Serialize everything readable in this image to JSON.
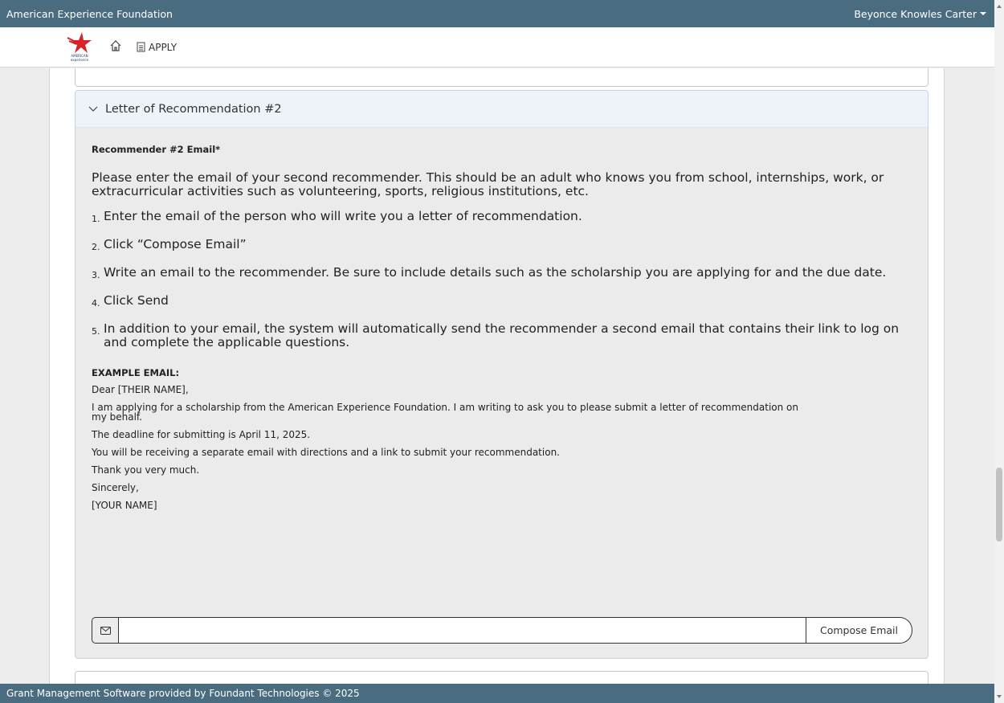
{
  "topbar": {
    "org_name": "American Experience Foundation",
    "user_name": "Beyonce Knowles Carter"
  },
  "navbar": {
    "logo_text": "AMERICAN",
    "logo_subtext": "experience",
    "apply_label": "APPLY"
  },
  "panel": {
    "title": "Letter of Recommendation #2",
    "field_label": "Recommender #2 Email*",
    "intro": "Please enter the email of your second recommender. This should be an adult who knows you from school, internships, work, or extracurricular activities such as volunteering, sports, religious institutions, etc.",
    "steps": [
      {
        "num": "1.",
        "text": "Enter the email of the person who will write you a letter of recommendation."
      },
      {
        "num": "2.",
        "text": "Click “Compose Email”"
      },
      {
        "num": "3.",
        "text": "Write an email to the recommender. Be sure to include details such as the scholarship you are applying for and the due date."
      },
      {
        "num": "4.",
        "text": "Click Send"
      },
      {
        "num": "5.",
        "text": "In addition to your email, the system will automatically send the recommender a second email that contains their link to log on and complete the applicable questions."
      }
    ],
    "example_heading": "EXAMPLE EMAIL:",
    "example_lines": [
      "Dear [THEIR NAME],",
      "I am applying for a scholarship from the American Experience Foundation. I am writing to ask you to please submit a letter of recommendation on my behalf.",
      "The deadline for submitting is April 11, 2025.",
      "You will be receiving a separate email with directions and a link to submit your recommendation.",
      "Thank you very much.",
      "Sincerely,",
      "[YOUR NAME]"
    ],
    "email_value": "",
    "compose_label": "Compose Email"
  },
  "footer": {
    "text": "Grant Management Software provided by Foundant Technologies © 2025"
  },
  "colors": {
    "topbar_bg": "#4a6c80",
    "logo_red": "#d6232a",
    "logo_navy": "#1c3b6e"
  }
}
